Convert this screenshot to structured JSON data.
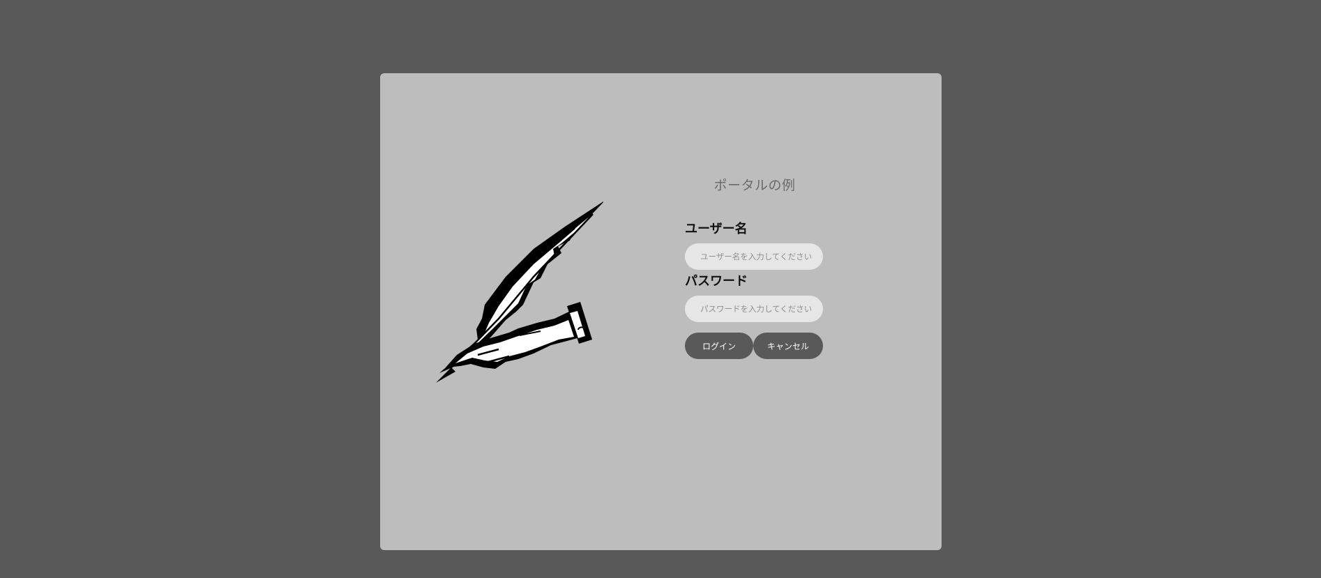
{
  "portal": {
    "title": "ポータルの例"
  },
  "form": {
    "username_label": "ユーザー名",
    "username_placeholder": "ユーザー名を入力してください",
    "username_value": "",
    "password_label": "パスワード",
    "password_placeholder": "パスワードを入力してください",
    "password_value": "",
    "login_label": "ログイン",
    "cancel_label": "キャンセル"
  },
  "illustration": {
    "icon": "quill-pen-hand-icon"
  },
  "colors": {
    "page_background": "#595959",
    "card_background": "#bdbdbd",
    "input_background": "#e6e6e6",
    "button_background": "#595959",
    "button_text": "#ffffff",
    "title_text": "#6a6a6a"
  }
}
